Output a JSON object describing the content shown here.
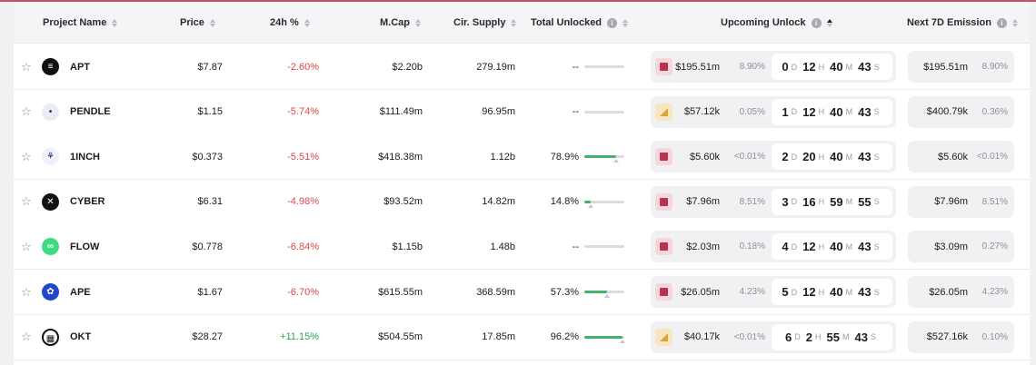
{
  "colors": {
    "negative": "#e0474b",
    "positive": "#2ea44f",
    "progress": "#44b26a",
    "accent_line": "#c0546a"
  },
  "columns": {
    "project": "Project Name",
    "price": "Price",
    "change": "24h %",
    "mcap": "M.Cap",
    "supply": "Cir. Supply",
    "unlocked": "Total Unlocked",
    "upcoming": "Upcoming Unlock",
    "emission": "Next 7D Emission"
  },
  "countdown_units": {
    "d": "D",
    "h": "H",
    "m": "M",
    "s": "S"
  },
  "rows": [
    {
      "name": "APT",
      "logo": "apt-logo-icon",
      "price": "$7.87",
      "change": "-2.60%",
      "dir": "neg",
      "mcap": "$2.20b",
      "supply": "279.19m",
      "unlocked": "--",
      "unlocked_fraction": null,
      "up_icon": "pink",
      "up_amount": "$195.51m",
      "up_pct": "8.90%",
      "cd": [
        "0",
        "12",
        "40",
        "43"
      ],
      "emit_amount": "$195.51m",
      "emit_pct": "8.90%"
    },
    {
      "name": "PENDLE",
      "logo": "pendle-logo-icon",
      "price": "$1.15",
      "change": "-5.74%",
      "dir": "neg",
      "mcap": "$111.49m",
      "supply": "96.95m",
      "unlocked": "--",
      "unlocked_fraction": null,
      "up_icon": "gold",
      "up_amount": "$57.12k",
      "up_pct": "0.05%",
      "cd": [
        "1",
        "12",
        "40",
        "43"
      ],
      "emit_amount": "$400.79k",
      "emit_pct": "0.36%"
    },
    {
      "name": "1INCH",
      "logo": "1inch-logo-icon",
      "price": "$0.373",
      "change": "-5.51%",
      "dir": "neg",
      "mcap": "$418.38m",
      "supply": "1.12b",
      "unlocked": "78.9%",
      "unlocked_fraction": 0.789,
      "up_icon": "pink",
      "up_amount": "$5.60k",
      "up_pct": "<0.01%",
      "cd": [
        "2",
        "20",
        "40",
        "43"
      ],
      "emit_amount": "$5.60k",
      "emit_pct": "<0.01%"
    },
    {
      "name": "CYBER",
      "logo": "cyber-logo-icon",
      "price": "$6.31",
      "change": "-4.98%",
      "dir": "neg",
      "mcap": "$93.52m",
      "supply": "14.82m",
      "unlocked": "14.8%",
      "unlocked_fraction": 0.148,
      "up_icon": "pink",
      "up_amount": "$7.96m",
      "up_pct": "8.51%",
      "cd": [
        "3",
        "16",
        "59",
        "55"
      ],
      "emit_amount": "$7.96m",
      "emit_pct": "8.51%"
    },
    {
      "name": "FLOW",
      "logo": "flow-logo-icon",
      "price": "$0.778",
      "change": "-6.84%",
      "dir": "neg",
      "mcap": "$1.15b",
      "supply": "1.48b",
      "unlocked": "--",
      "unlocked_fraction": null,
      "up_icon": "pink",
      "up_amount": "$2.03m",
      "up_pct": "0.18%",
      "cd": [
        "4",
        "12",
        "40",
        "43"
      ],
      "emit_amount": "$3.09m",
      "emit_pct": "0.27%"
    },
    {
      "name": "APE",
      "logo": "ape-logo-icon",
      "price": "$1.67",
      "change": "-6.70%",
      "dir": "neg",
      "mcap": "$615.55m",
      "supply": "368.59m",
      "unlocked": "57.3%",
      "unlocked_fraction": 0.573,
      "up_icon": "pink",
      "up_amount": "$26.05m",
      "up_pct": "4.23%",
      "cd": [
        "5",
        "12",
        "40",
        "43"
      ],
      "emit_amount": "$26.05m",
      "emit_pct": "4.23%"
    },
    {
      "name": "OKT",
      "logo": "okt-logo-icon",
      "price": "$28.27",
      "change": "+11.15%",
      "dir": "pos",
      "mcap": "$504.55m",
      "supply": "17.85m",
      "unlocked": "96.2%",
      "unlocked_fraction": 0.962,
      "up_icon": "gold",
      "up_amount": "$40.17k",
      "up_pct": "<0.01%",
      "cd": [
        "6",
        "2",
        "55",
        "43"
      ],
      "emit_amount": "$527.16k",
      "emit_pct": "0.10%"
    }
  ]
}
